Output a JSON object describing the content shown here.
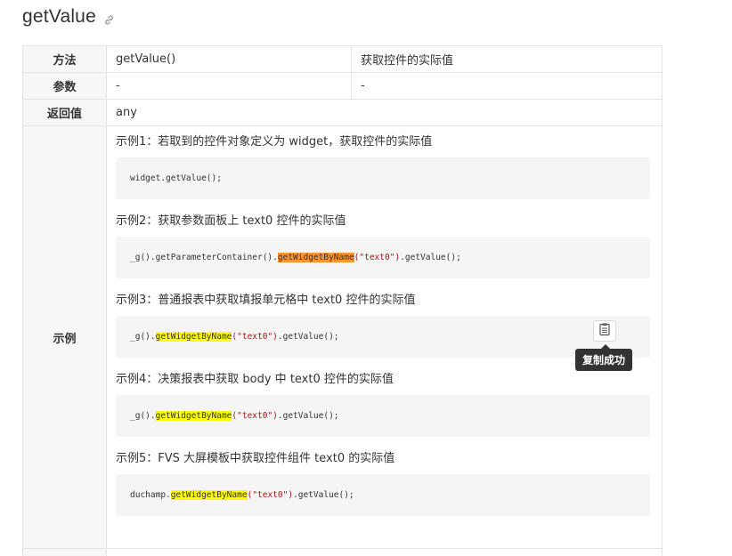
{
  "header": {
    "title": "getValue",
    "anchor_icon": "link-icon"
  },
  "table": {
    "rows": {
      "method": {
        "label": "方法",
        "signature": "getValue()",
        "description": "获取控件的实际值"
      },
      "params": {
        "label": "参数",
        "value1": "-",
        "value2": "-"
      },
      "returns": {
        "label": "返回值",
        "value": "any"
      },
      "examples": {
        "label": "示例"
      }
    }
  },
  "examples": [
    {
      "title": "示例1：若取到的控件对象定义为 widget，获取控件的实际值",
      "code": {
        "pre": "widget.getValue();",
        "hl": "",
        "hl_color": "",
        "str": "",
        "post": ""
      }
    },
    {
      "title": "示例2：获取参数面板上 text0 控件的实际值",
      "code": {
        "pre": "_g().getParameterContainer().",
        "hl": "getWidgetByName",
        "hl_color": "orange",
        "str": "(\"text0\")",
        "post": ".getValue();"
      }
    },
    {
      "title": "示例3：普通报表中获取填报单元格中 text0 控件的实际值",
      "code": {
        "pre": "_g().",
        "hl": "getWidgetByName",
        "hl_color": "yellow",
        "str": "(\"text0\")",
        "post": ".getValue();"
      }
    },
    {
      "title": "示例4：决策报表中获取 body 中 text0 控件的实际值",
      "code": {
        "pre": "_g().",
        "hl": "getWidgetByName",
        "hl_color": "yellow",
        "str": "(\"text0\")",
        "post": ".getValue();"
      }
    },
    {
      "title": "示例5：FVS 大屏模板中获取控件组件 text0 的实际值",
      "code": {
        "pre": "duchamp.",
        "hl": "getWidgetByName",
        "hl_color": "yellow",
        "str": "(\"text0\")",
        "post": ".getValue();"
      }
    }
  ],
  "copy_button": {
    "icon": "clipboard-icon",
    "tooltip": "复制成功"
  },
  "colors": {
    "highlight_yellow": "#ffff00",
    "highlight_orange": "#ff9632",
    "tooltip_bg": "#333333",
    "code_bg": "#f5f5f5"
  }
}
